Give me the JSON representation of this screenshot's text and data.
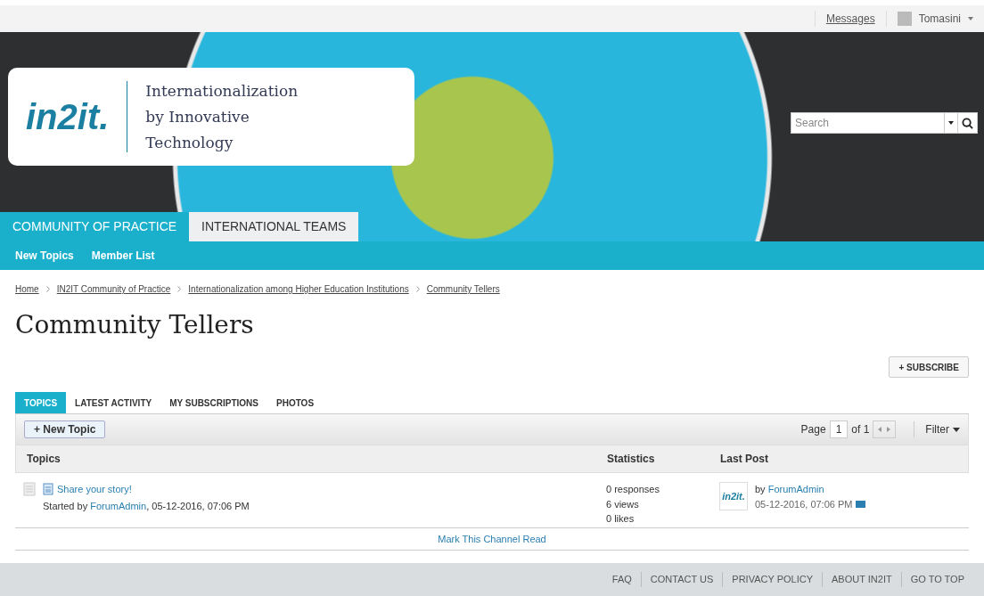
{
  "top_bar": {
    "messages": "Messages",
    "user": "Tomasini"
  },
  "header": {
    "logo": "in2it.",
    "tagline": [
      "Internationalization",
      "by Innovative",
      "Technology"
    ],
    "search": {
      "placeholder": "Search"
    }
  },
  "main_tabs": [
    {
      "label": "COMMUNITY OF PRACTICE",
      "selected": true
    },
    {
      "label": "INTERNATIONAL TEAMS",
      "selected": false
    }
  ],
  "sub_nav": [
    "New Topics",
    "Member List"
  ],
  "breadcrumb": [
    "Home",
    "IN2IT Community of Practice",
    "Internationalization among Higher Education Institutions",
    "Community Tellers"
  ],
  "page_title": "Community Tellers",
  "subscribe": "+ SUBSCRIBE",
  "channel_tabs": [
    {
      "label": "TOPICS",
      "selected": true
    },
    {
      "label": "LATEST ACTIVITY",
      "selected": false
    },
    {
      "label": "MY SUBSCRIPTIONS",
      "selected": false
    },
    {
      "label": "PHOTOS",
      "selected": false
    }
  ],
  "toolbar": {
    "new_topic": "+ New Topic",
    "page_label": "Page",
    "page": "1",
    "of": "of 1",
    "filter": "Filter"
  },
  "table": {
    "columns": [
      "Topics",
      "Statistics",
      "Last Post"
    ],
    "rows": [
      {
        "title": "Share your story!",
        "started_by": "Started by",
        "author": "ForumAdmin",
        "date": ", 05-12-2016, 07:06 PM",
        "stats": [
          "0 responses",
          "6 views",
          "0 likes"
        ],
        "last_avatar": "in2it.",
        "last_by": "by",
        "last_author": "ForumAdmin",
        "last_date": "05-12-2016, 07:06 PM"
      }
    ]
  },
  "mark_read": "Mark This Channel Read",
  "footer": [
    "FAQ",
    "CONTACT US",
    "PRIVACY POLICY",
    "ABOUT IN2IT",
    "GO TO TOP"
  ]
}
